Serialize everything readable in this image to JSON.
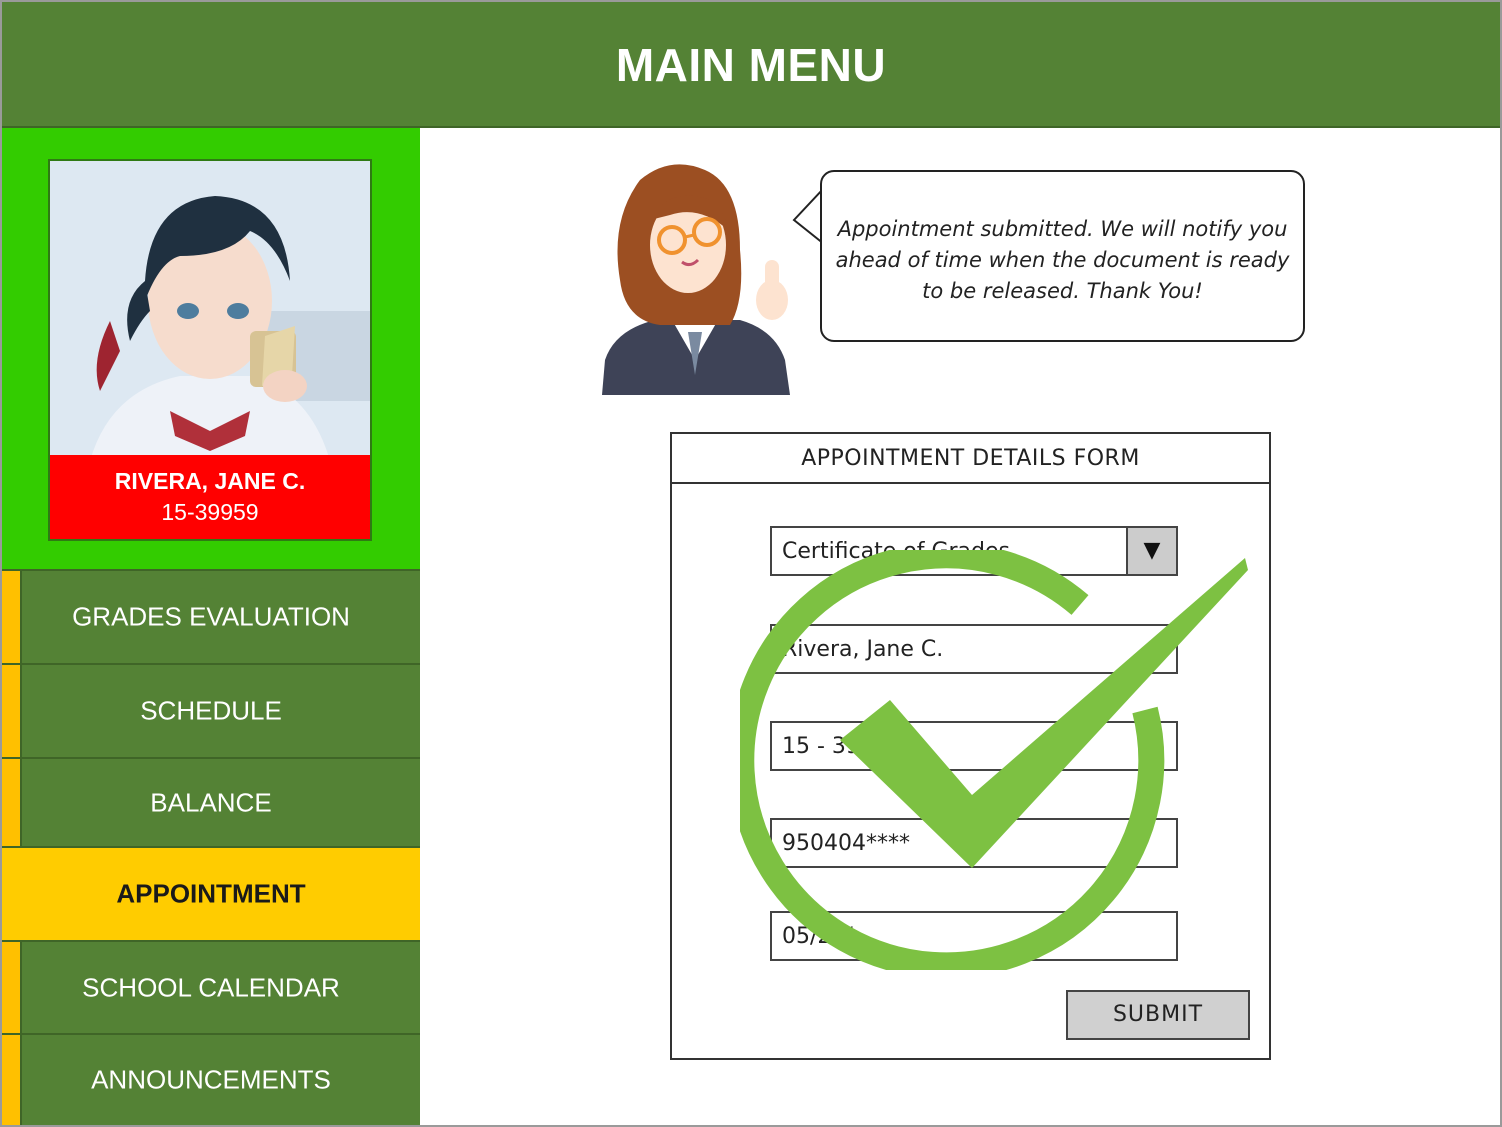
{
  "header": {
    "title": "MAIN MENU"
  },
  "profile": {
    "name": "RIVERA, JANE C.",
    "student_id": "15-39959"
  },
  "menu": {
    "items": [
      {
        "label": "GRADES EVALUATION"
      },
      {
        "label": "SCHEDULE"
      },
      {
        "label": "BALANCE"
      },
      {
        "label": "APPOINTMENT",
        "active": true
      },
      {
        "label": "SCHOOL CALENDAR"
      },
      {
        "label": "ANNOUNCEMENTS"
      }
    ]
  },
  "message": {
    "text": "Appointment submitted. We will notify you ahead of time when the document is ready to be released. Thank You!"
  },
  "form": {
    "title": "APPOINTMENT DETAILS FORM",
    "document_type": "Certificate of Grades",
    "name": "Rivera, Jane C.",
    "student_number": "15 - 39",
    "birthdate": "950404****",
    "date": "05/20/",
    "submit_label": "SUBMIT",
    "dropdown_icon": "triangle-down-icon"
  },
  "overlay": {
    "icon": "success-check-icon",
    "color": "#7dc142"
  },
  "colors": {
    "header_green": "#548235",
    "profile_green": "#33cc00",
    "name_red": "#ff0000",
    "accent_yellow": "#ffc000",
    "active_yellow": "#ffcc00"
  }
}
